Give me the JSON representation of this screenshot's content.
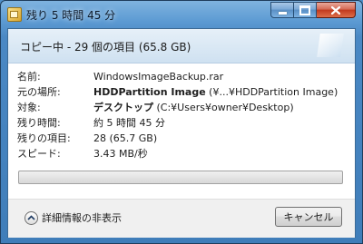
{
  "window": {
    "title": "残り 5 時間 45 分"
  },
  "header": {
    "text": "コピー中 - 29 個の項目 (65.8 GB)"
  },
  "details": [
    {
      "label": "名前:",
      "value": "WindowsImageBackup.rar",
      "value_strong": "",
      "value_rest": ""
    },
    {
      "label": "元の場所:",
      "value": "",
      "value_strong": "HDDPartition Image",
      "value_rest": " (¥...¥HDDPartition Image)"
    },
    {
      "label": "対象:",
      "value": "",
      "value_strong": "デスクトップ",
      "value_rest": " (C:¥Users¥owner¥Desktop)"
    },
    {
      "label": "残り時間:",
      "value": "約 5 時間 45 分",
      "value_strong": "",
      "value_rest": ""
    },
    {
      "label": "残りの項目:",
      "value": "28 (65.7 GB)",
      "value_strong": "",
      "value_rest": ""
    },
    {
      "label": "スピード:",
      "value": "3.43 MB/秒",
      "value_strong": "",
      "value_rest": ""
    }
  ],
  "progress": {
    "percent": 0
  },
  "footer": {
    "toggle_label": "詳細情報の非表示",
    "cancel_label": "キャンセル"
  },
  "icons": {
    "app": "file-copy-icon",
    "minimize": "minimize-icon",
    "maximize": "maximize-icon",
    "close": "close-icon",
    "toggle": "chevron-up-icon"
  },
  "colors": {
    "frame": "#4f8fc9",
    "header_bg": "#d8e7f4",
    "progress_fill": "#38b52b",
    "close_button": "#c1391e"
  }
}
